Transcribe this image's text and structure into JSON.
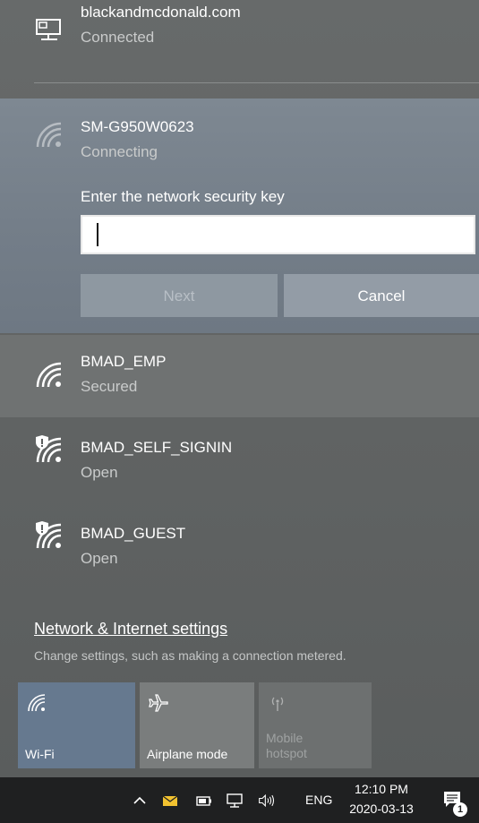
{
  "networks": {
    "connected": {
      "name": "blackandmcdonald.com",
      "status": "Connected",
      "icon": "ethernet-icon"
    },
    "active": {
      "name": "SM-G950W0623",
      "status": "Connecting",
      "icon": "wifi-icon",
      "key_label": "Enter the network security key",
      "key_value": "",
      "next_label": "Next",
      "cancel_label": "Cancel"
    },
    "list": [
      {
        "name": "BMAD_EMP",
        "status": "Secured",
        "icon": "wifi-icon"
      },
      {
        "name": "BMAD_SELF_SIGNIN",
        "status": "Open",
        "icon": "wifi-open-shield-icon"
      },
      {
        "name": "BMAD_GUEST",
        "status": "Open",
        "icon": "wifi-open-shield-icon"
      }
    ]
  },
  "settings": {
    "link": "Network & Internet settings",
    "description": "Change settings, such as making a connection metered."
  },
  "quick_actions": {
    "wifi": "Wi-Fi",
    "airplane": "Airplane mode",
    "hotspot_line1": "Mobile",
    "hotspot_line2": "hotspot"
  },
  "taskbar": {
    "language": "ENG",
    "time": "12:10 PM",
    "date": "2020-03-13",
    "notifications_count": "1"
  },
  "colors": {
    "accent": "#66798f",
    "taskbar": "#1f2021",
    "flyout_bg": "#636666"
  }
}
